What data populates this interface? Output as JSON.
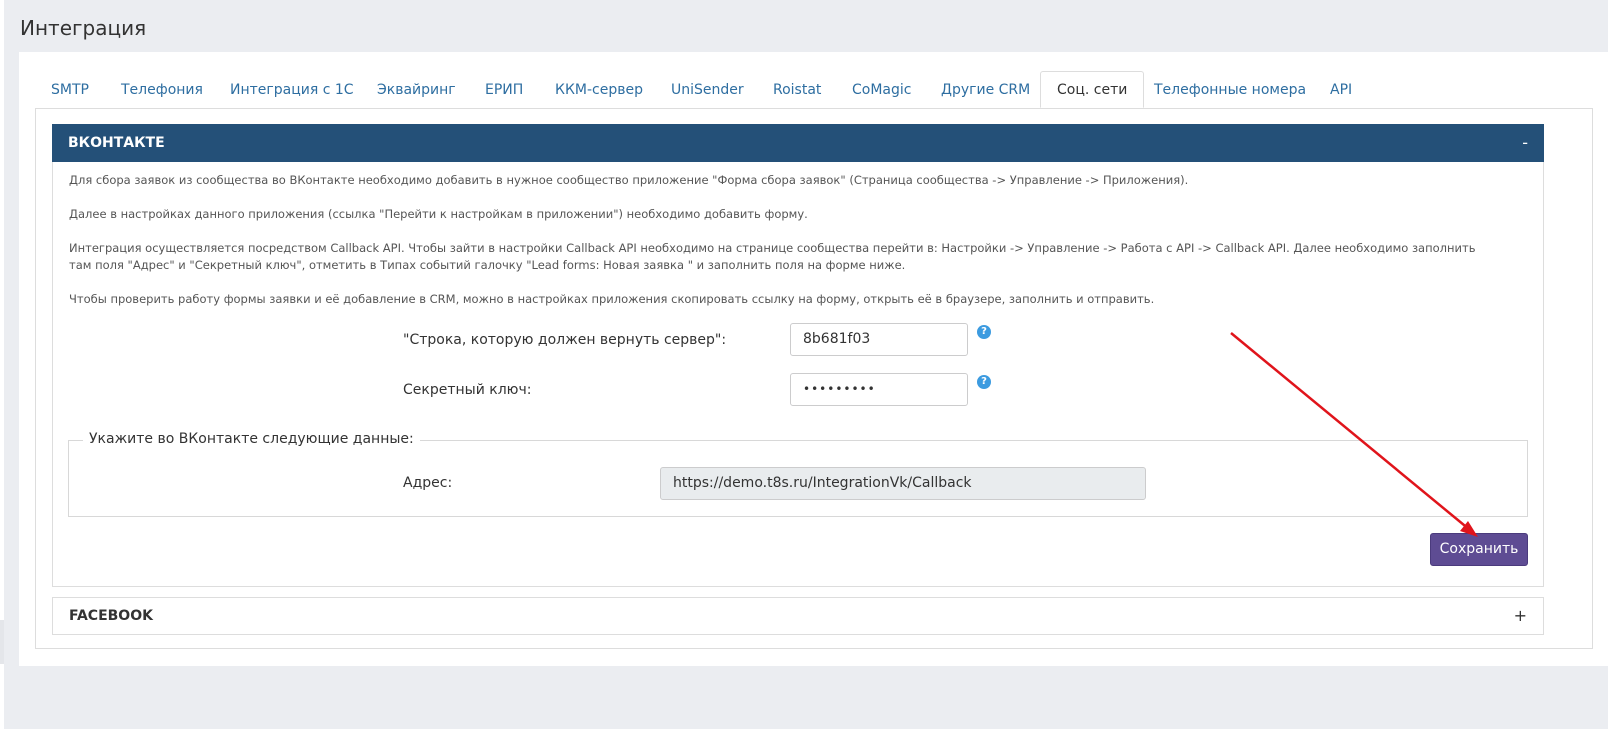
{
  "page": {
    "title": "Интеграция"
  },
  "tabs": [
    {
      "label": "SMTP"
    },
    {
      "label": "Телефония"
    },
    {
      "label": "Интеграция с 1С"
    },
    {
      "label": "Эквайринг"
    },
    {
      "label": "ЕРИП"
    },
    {
      "label": "ККМ-сервер"
    },
    {
      "label": "UniSender"
    },
    {
      "label": "Roistat"
    },
    {
      "label": "CoMagic"
    },
    {
      "label": "Другие CRM"
    },
    {
      "label": "Соц. сети",
      "active": true
    },
    {
      "label": "Телефонные номера"
    },
    {
      "label": "API"
    }
  ],
  "vk": {
    "header": "ВКОНТАКТЕ",
    "toggle": "-",
    "paragraphs": [
      "Для сбора заявок из сообщества во ВКонтакте необходимо добавить в нужное сообщество приложение \"Форма сбора заявок\" (Страница сообщества -> Управление -> Приложения).",
      "Далее в настройках данного приложения (ссылка \"Перейти к настройкам в приложении\") необходимо добавить форму.",
      "Интеграция осуществляется посредством Callback API. Чтобы зайти в настройки Callback API необходимо на странице сообщества перейти в: Настройки -> Управление -> Работа с API -> Callback API. Далее необходимо заполнить там поля \"Адрес\" и \"Секретный ключ\", отметить в Типах событий галочку \"Lead forms: Новая заявка \" и заполнить поля на форме ниже.",
      "Чтобы проверить работу формы заявки и её добавление в CRM, можно в настройках приложения скопировать ссылку на форму, открыть её в браузере, заполнить и отправить."
    ],
    "server_string_label": "\"Строка, которую должен вернуть сервер\":",
    "server_string_value": "8b681f03",
    "secret_key_label": "Секретный ключ:",
    "secret_key_value": "•••••••••",
    "help_glyph": "?",
    "fieldset_legend": "Укажите во ВКонтакте следующие данные:",
    "address_label": "Адрес:",
    "address_value": "https://demo.t8s.ru/IntegrationVk/Callback",
    "save_label": "Сохранить"
  },
  "facebook": {
    "header": "FACEBOOK",
    "toggle": "+"
  },
  "colors": {
    "accent_header": "#245078",
    "link": "#2e6ea1",
    "save_button": "#5e4c93",
    "annotation_arrow": "#e0141b"
  }
}
